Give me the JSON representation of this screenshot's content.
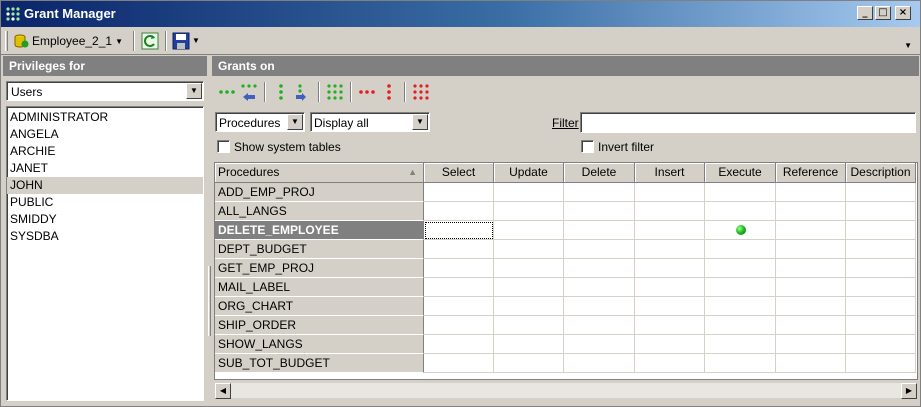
{
  "window": {
    "title": "Grant Manager"
  },
  "toolbar": {
    "database_label": "Employee_2_1",
    "refresh_icon": "refresh-icon",
    "save_icon": "save-icon"
  },
  "left_pane": {
    "header": "Privileges for",
    "type_select": {
      "value": "Users"
    },
    "users": [
      "ADMINISTRATOR",
      "ANGELA",
      "ARCHIE",
      "JANET",
      "JOHN",
      "PUBLIC",
      "SMIDDY",
      "SYSDBA"
    ],
    "selected_user": "JOHN"
  },
  "right_pane": {
    "header": "Grants on",
    "object_type_select": {
      "value": "Procedures"
    },
    "display_select": {
      "value": "Display all"
    },
    "filter_label": "Filter",
    "filter_value": "",
    "show_system_tables_label": "Show system tables",
    "invert_filter_label": "Invert filter",
    "grid": {
      "columns": [
        "Procedures",
        "Select",
        "Update",
        "Delete",
        "Insert",
        "Execute",
        "Reference",
        "Description"
      ],
      "rows": [
        {
          "name": "ADD_EMP_PROJ",
          "execute": false
        },
        {
          "name": "ALL_LANGS",
          "execute": false
        },
        {
          "name": "DELETE_EMPLOYEE",
          "execute": true,
          "selected": true
        },
        {
          "name": "DEPT_BUDGET",
          "execute": false
        },
        {
          "name": "GET_EMP_PROJ",
          "execute": false
        },
        {
          "name": "MAIL_LABEL",
          "execute": false
        },
        {
          "name": "ORG_CHART",
          "execute": false
        },
        {
          "name": "SHIP_ORDER",
          "execute": false
        },
        {
          "name": "SHOW_LANGS",
          "execute": false
        },
        {
          "name": "SUB_TOT_BUDGET",
          "execute": false
        }
      ]
    }
  },
  "colors": {
    "title_start": "#0a246a",
    "title_end": "#a6caf0",
    "face": "#d4d0c8",
    "grant_green": "#20c020",
    "revoke_red": "#e02020"
  }
}
